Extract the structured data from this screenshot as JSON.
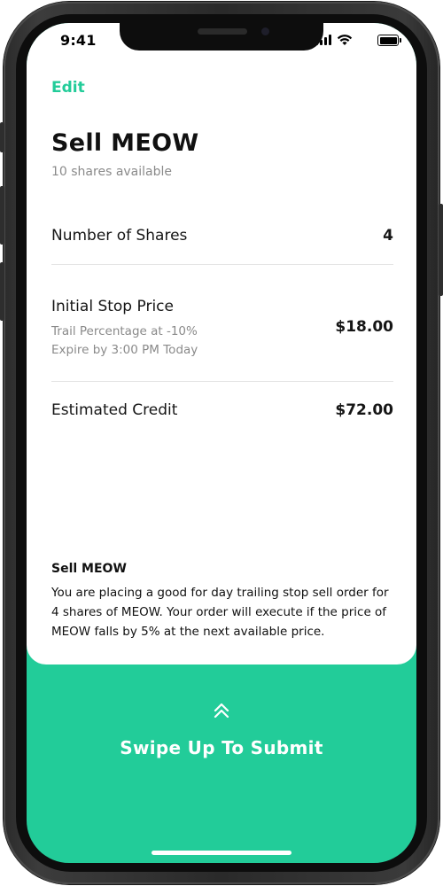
{
  "status_bar": {
    "time": "9:41"
  },
  "header": {
    "edit_label": "Edit"
  },
  "order": {
    "title": "Sell MEOW",
    "subtitle": "10 shares available",
    "shares_label": "Number of Shares",
    "shares_value": "4",
    "stop_price_label": "Initial Stop Price",
    "stop_price_detail_1": "Trail Percentage at -10%",
    "stop_price_detail_2": "Expire by 3:00 PM Today",
    "stop_price_value": "$18.00",
    "credit_label": "Estimated Credit",
    "credit_value": "$72.00"
  },
  "summary": {
    "title": "Sell MEOW",
    "text": "You are placing a good for day trailing stop sell order for 4 shares of MEOW. Your order will execute if the price of MEOW falls by 5% at the next available price."
  },
  "submit": {
    "label": "Swipe Up To Submit",
    "icon": "double-chevron-up-icon"
  },
  "colors": {
    "accent": "#22cc99",
    "text": "#111111",
    "muted": "#8a8a8a"
  }
}
